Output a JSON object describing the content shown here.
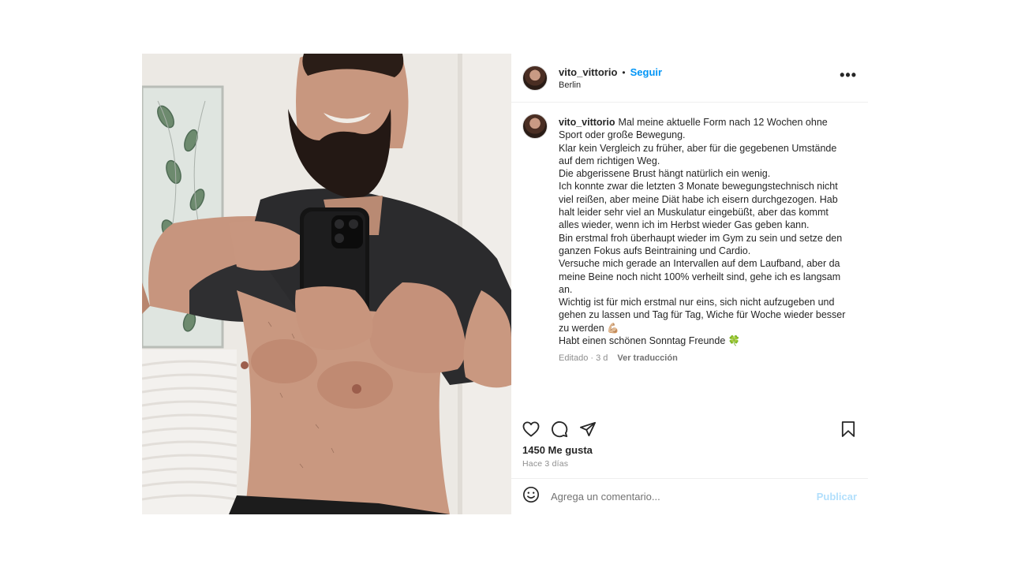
{
  "header": {
    "username": "vito_vittorio",
    "separator": "•",
    "follow_label": "Seguir",
    "location": "Berlin",
    "more_label": "•••"
  },
  "caption": {
    "username": "vito_vittorio",
    "lines": [
      "Mal meine aktuelle Form nach 12 Wochen ohne Sport oder große Bewegung.",
      "Klar kein Vergleich zu früher, aber für die gegebenen Umstände auf dem richtigen Weg.",
      "Die abgerissene Brust hängt natürlich ein wenig.",
      "Ich konnte zwar die letzten 3 Monate bewegungstechnisch nicht viel reißen, aber meine Diät habe ich eisern durchgezogen. Hab halt leider sehr viel an Muskulatur eingebüßt, aber das kommt alles wieder, wenn ich im Herbst wieder Gas geben kann.",
      "Bin erstmal froh überhaupt wieder im Gym zu sein und setze den ganzen Fokus aufs Beintraining und Cardio.",
      "Versuche mich gerade an Intervallen auf dem Laufband, aber da meine Beine noch nicht 100% verheilt sind, gehe ich es langsam an.",
      "Wichtig ist für mich erstmal nur eins, sich nicht aufzugeben und gehen zu lassen und Tag für Tag, Wiche für Woche wieder besser zu werden 💪🏼",
      "Habt einen schönen Sonntag Freunde 🍀"
    ],
    "edited_label": "Editado · 3 d",
    "translate_label": "Ver traducción"
  },
  "actions": {
    "like_icon": "heart-icon",
    "comment_icon": "comment-icon",
    "share_icon": "share-icon",
    "save_icon": "bookmark-icon"
  },
  "likes": "1450 Me gusta",
  "date": "Hace 3 días",
  "comment_box": {
    "emoji_icon": "emoji-icon",
    "placeholder": "Agrega un comentario...",
    "publish_label": "Publicar"
  },
  "colors": {
    "link": "#0095f6",
    "publish_disabled": "#b2dffc",
    "muted": "#8e8e8e"
  }
}
